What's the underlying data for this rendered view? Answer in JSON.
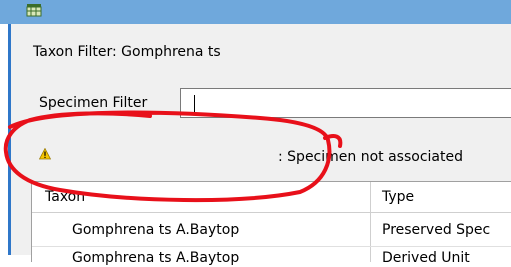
{
  "window": {
    "app_icon": "grid-app-icon"
  },
  "taxon_filter": {
    "label": "Taxon Filter: Gomphrena ts"
  },
  "specimen_filter": {
    "label": "Specimen Filter",
    "value": ""
  },
  "warning": {
    "icon": "warning-icon",
    "text": ": Specimen not associated"
  },
  "table": {
    "columns": [
      "Taxon",
      "Type"
    ],
    "rows": [
      {
        "taxon": "Gomphrena ts A.Baytop",
        "type": "Preserved Spec"
      },
      {
        "taxon": "Gomphrena ts A.Baytop",
        "type": "Derived Unit"
      }
    ]
  },
  "annotation": {
    "color": "#e8101a"
  }
}
